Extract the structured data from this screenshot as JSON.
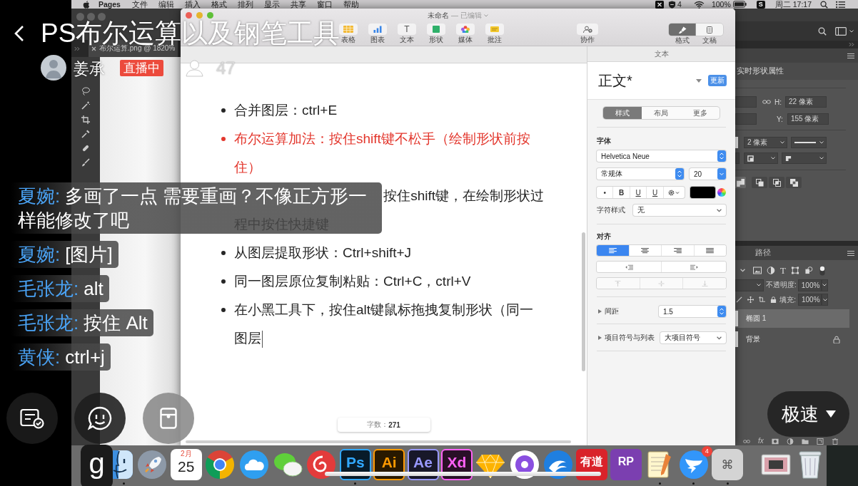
{
  "stream": {
    "title": "PS布尔运算以及钢笔工具",
    "host": "姜承",
    "live_badge": "直播中",
    "viewers": "47",
    "quality": "极速",
    "logo": "g"
  },
  "menu_bar": {
    "app_name": "Pages",
    "menus": [
      "文件",
      "编辑",
      "插入",
      "格式",
      "排列",
      "显示",
      "共享",
      "窗口",
      "帮助"
    ],
    "tray_count": "4",
    "battery": "100%",
    "input_method": "S",
    "clock": "周二 17:17"
  },
  "photoshop": {
    "document_tab": "布尔运算.png @ 1820%",
    "properties": {
      "title": "实时形状属性",
      "h_label": "H:",
      "h_value": "22 像素",
      "y_label": "Y:",
      "y_value": "155 像素",
      "stroke_width": "2 像素"
    },
    "layers": {
      "tab": "路径",
      "type_filter": "T",
      "opacity_label": "不透明度:",
      "opacity": "100%",
      "fill_label": "填充:",
      "fill": "100%",
      "items": [
        {
          "name": "椭圆 1",
          "selected": true,
          "locked": false
        },
        {
          "name": "背景",
          "selected": false,
          "locked": true
        }
      ],
      "effects_label": "fx"
    }
  },
  "pages": {
    "title": "未命名",
    "status": "— 已编辑",
    "toolbar": [
      {
        "label": "表格",
        "kind": "table"
      },
      {
        "label": "图表",
        "kind": "chart"
      },
      {
        "label": "文本",
        "kind": "text",
        "glyph": "T"
      },
      {
        "label": "形状",
        "kind": "shape"
      },
      {
        "label": "媒体",
        "kind": "media"
      },
      {
        "label": "批注",
        "kind": "comment"
      }
    ],
    "collaborate": "协作",
    "view_tabs": [
      {
        "label": "格式",
        "kind": "format",
        "selected": true
      },
      {
        "label": "文稿",
        "kind": "document",
        "selected": false
      }
    ],
    "document": {
      "items": [
        {
          "kind": "bullet",
          "text": "合并图层：ctrl+E",
          "color": "#262626",
          "caret": false
        },
        {
          "kind": "bullet",
          "text": "布尔运算加法：按住shift键不松手（绘制形状前按住）",
          "color": "#e3372d",
          "caret": false
        },
        {
          "kind": "covered",
          "text": "按住shift键，在绘制形状过",
          "continuation": "程中按住快捷键",
          "color": "#262626",
          "caret": false
        },
        {
          "kind": "bullet",
          "text": "从图层提取形状：Ctrl+shift+J",
          "color": "#262626",
          "caret": false
        },
        {
          "kind": "bullet",
          "text": "同一图层原位复制粘贴：Ctrl+C，ctrl+V",
          "color": "#262626",
          "caret": false
        },
        {
          "kind": "bullet",
          "text": "在小黑工具下，按住alt键鼠标拖拽复制形状（同一图层",
          "color": "#262626",
          "caret": true
        }
      ]
    },
    "word_count_label": "字数：",
    "word_count": "271",
    "inspector": {
      "header": "文本",
      "paragraph_style": "正文*",
      "update_button": "更新",
      "tabs": [
        {
          "label": "样式",
          "selected": true
        },
        {
          "label": "布局",
          "selected": false
        },
        {
          "label": "更多",
          "selected": false
        }
      ],
      "font_label": "字体",
      "font_family": "Helvetica Neue",
      "font_style": "常规体",
      "font_size": "20",
      "style_buttons": [
        {
          "label": "•",
          "kind": "plain"
        },
        {
          "label": "B",
          "kind": "bold"
        },
        {
          "label": "U",
          "kind": "underline"
        },
        {
          "label": "U",
          "kind": "underline"
        }
      ],
      "char_style_label": "字符样式",
      "char_style": "无",
      "alignment_label": "对齐",
      "alignment": [
        {
          "kind": "left",
          "selected": true
        },
        {
          "kind": "center",
          "selected": false
        },
        {
          "kind": "right",
          "selected": false
        },
        {
          "kind": "justify",
          "selected": false
        }
      ],
      "indent": [
        {
          "kind": "decrease"
        },
        {
          "kind": "increase"
        }
      ],
      "vertical_alignment": [
        {
          "kind": "top",
          "disabled": true
        },
        {
          "kind": "middle",
          "disabled": true
        },
        {
          "kind": "bottom",
          "disabled": true
        }
      ],
      "spacing_label": "间距",
      "spacing": "1.5",
      "bullets_label": "项目符号与列表",
      "bullets": "大项目符号"
    }
  },
  "chat": [
    {
      "user": "夏婉:",
      "message": "多画了一点 需要重画？不像正方形一样能修改了吧"
    },
    {
      "user": "夏婉:",
      "message": "[图片]"
    },
    {
      "user": "毛张龙:",
      "message": "alt"
    },
    {
      "user": "毛张龙:",
      "message": "按住 Alt"
    },
    {
      "user": "黄侠:",
      "message": "ctrl+j"
    }
  ],
  "dock": {
    "apps": [
      {
        "kind": "finder",
        "running": true
      },
      {
        "kind": "rocket",
        "running": false
      },
      {
        "kind": "calendar",
        "month": "2月",
        "label": "25",
        "running": false
      },
      {
        "kind": "tricolor",
        "running": false
      },
      {
        "kind": "cloud",
        "running": false
      },
      {
        "kind": "chat",
        "running": false
      },
      {
        "kind": "swirl",
        "running": false
      },
      {
        "kind": "outlined",
        "label": "Ps",
        "color": "#31a8ff",
        "running": true
      },
      {
        "kind": "outlined",
        "label": "Ai",
        "color": "#ff9a00",
        "running": false
      },
      {
        "kind": "outlined",
        "label": "Ae",
        "color": "#9999ff",
        "running": false
      },
      {
        "kind": "outlined",
        "label": "Xd",
        "color": "#ff61f6",
        "running": false
      },
      {
        "kind": "gem",
        "running": false
      },
      {
        "kind": "disc",
        "running": false
      },
      {
        "kind": "wave",
        "running": false
      },
      {
        "kind": "filled",
        "label": "有道",
        "color": "#d9232a",
        "running": false
      },
      {
        "kind": "filled",
        "label": "RP",
        "color": "#7b3fb0",
        "running": false
      },
      {
        "kind": "notepad",
        "running": true
      },
      {
        "kind": "wing",
        "badge": "4",
        "running": true
      },
      {
        "kind": "glyph",
        "label": "⌘",
        "running": true
      }
    ],
    "others": [
      {
        "kind": "window"
      },
      {
        "kind": "trash"
      }
    ]
  }
}
